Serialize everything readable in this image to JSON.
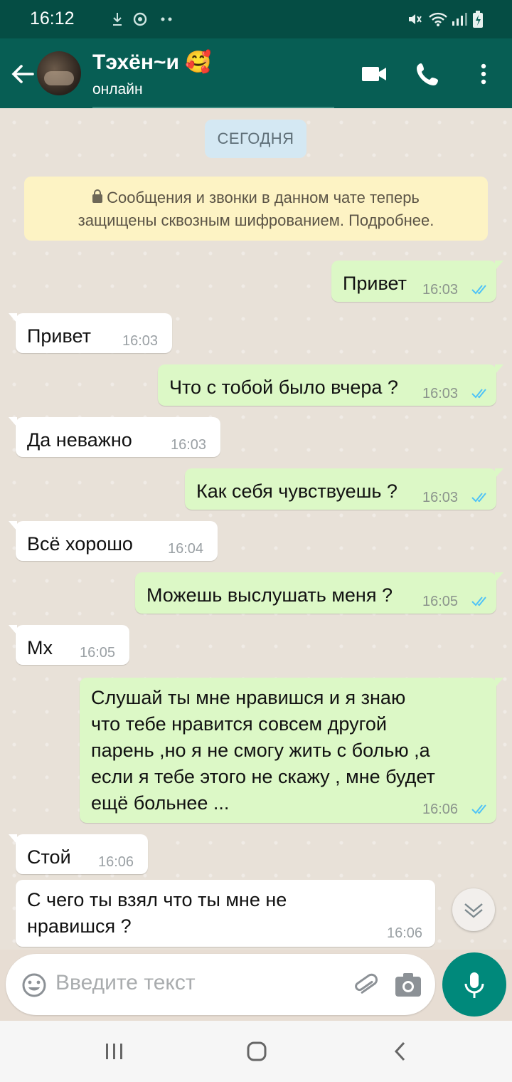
{
  "status_bar": {
    "time": "16:12"
  },
  "header": {
    "contact_name": "Тэхён~и 🥰",
    "contact_status": "онлайн"
  },
  "chat": {
    "date_chip": "СЕГОДНЯ",
    "encryption_notice_line1": "Сообщения и звонки в данном чате теперь",
    "encryption_notice_line2": "защищены сквозным шифрованием. Подробнее.",
    "messages": [
      {
        "direction": "outgoing",
        "text": "Привет",
        "time": "16:03",
        "status": "read"
      },
      {
        "direction": "incoming",
        "text": "Привет",
        "time": "16:03"
      },
      {
        "direction": "outgoing",
        "text": "Что с тобой было вчера ?",
        "time": "16:03",
        "status": "read"
      },
      {
        "direction": "incoming",
        "text": "Да неважно",
        "time": "16:03"
      },
      {
        "direction": "outgoing",
        "text": "Как себя чувствуешь ?",
        "time": "16:03",
        "status": "read"
      },
      {
        "direction": "incoming",
        "text": "Всё хорошо",
        "time": "16:04"
      },
      {
        "direction": "outgoing",
        "text": "Можешь выслушать меня ?",
        "time": "16:05",
        "status": "read"
      },
      {
        "direction": "incoming",
        "text": "Мх",
        "time": "16:05"
      },
      {
        "direction": "outgoing",
        "text": "Слушай ты мне нравишся и я знаю\nчто тебе нравится совсем другой\nпарень ,но я не смогу жить с болью ,а\nесли я тебе этого не скажу , мне будет\nещё больнее ...",
        "time": "16:06",
        "status": "read"
      },
      {
        "direction": "incoming",
        "text": "Стой",
        "time": "16:06"
      },
      {
        "direction": "incoming",
        "text": "С чего ты взял что ты мне не\nнравишся ?",
        "time": "16:06"
      }
    ]
  },
  "composer": {
    "placeholder": "Введите текст"
  },
  "colors": {
    "header": "#075e54",
    "outgoing_bubble": "#dcf8c6",
    "incoming_bubble": "#ffffff",
    "accent": "#00897b",
    "read_ticks": "#4fc3f7"
  },
  "icons": [
    "back-arrow-icon",
    "video-call-icon",
    "phone-icon",
    "more-vert-icon",
    "lock-icon",
    "double-check-icon",
    "chevron-down-icon",
    "emoji-icon",
    "attach-icon",
    "camera-icon",
    "mic-icon",
    "recents-icon",
    "home-icon",
    "back-nav-icon"
  ]
}
